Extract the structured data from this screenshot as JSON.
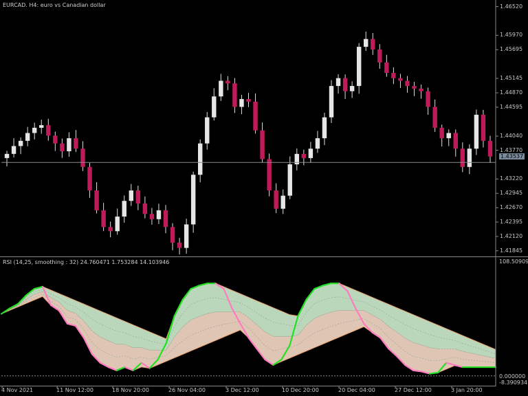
{
  "price_chart": {
    "symbol": "EURCAD.",
    "timeframe": "H4:",
    "description": "euro vs Canadian dollar",
    "price_axis_labels": [
      "1.46520",
      "1.45970",
      "1.45695",
      "1.45145",
      "1.44870",
      "1.44595",
      "1.44040",
      "1.43770",
      "1.43220",
      "1.42945",
      "1.42670",
      "1.42395",
      "1.42120",
      "1.41845"
    ],
    "current_price_label": "1.43537",
    "current_price": 1.43537
  },
  "indicator": {
    "header": "RSI (14,25, smoothing : 32) 24.760471 1.753284 14.103946",
    "axis_max_label": "108.509099",
    "axis_zero_label": "0.000000",
    "axis_min_label": "-8.390934"
  },
  "time_axis_labels": [
    "4 Nov 2021",
    "11 Nov 12:00",
    "18 Nov 20:00",
    "26 Nov 04:00",
    "3 Dec 12:00",
    "10 Dec 20:00",
    "20 Dec 04:00",
    "27 Dec 12:00",
    "3 Jan 20:00"
  ],
  "colors": {
    "background": "#000000",
    "candle": "#c01a5a",
    "candle_wick": "#e0e0e0",
    "rsi_up": "#22e022",
    "rsi_down": "#ff7ac0",
    "band_upper_fill": "#cfeecf",
    "band_lower_fill": "#f7dcc8",
    "band_edge": "#e8a070",
    "axis_text": "#c8c8c8"
  },
  "chart_data": {
    "type": "line",
    "title": "",
    "series": [
      {
        "name": "EURCAD.",
        "type": "candlestick",
        "x": [
          0,
          1,
          2,
          3,
          4,
          5,
          6,
          7,
          8,
          9,
          10,
          11,
          12,
          13,
          14,
          15,
          16,
          17,
          18,
          19,
          20,
          21,
          22,
          23,
          24,
          25,
          26,
          27,
          28,
          29,
          30,
          31,
          32,
          33,
          34,
          35,
          36,
          37,
          38,
          39,
          40,
          41,
          42,
          43,
          44,
          45,
          46,
          47,
          48,
          49,
          50,
          51,
          52,
          53,
          54,
          55,
          56,
          57,
          58,
          59,
          60,
          61,
          62,
          63,
          64,
          65,
          66,
          67,
          68,
          69,
          70
        ],
        "values": [
          1.437,
          1.4385,
          1.4395,
          1.441,
          1.442,
          1.4425,
          1.4405,
          1.439,
          1.4375,
          1.44,
          1.438,
          1.4345,
          1.43,
          1.4262,
          1.423,
          1.4222,
          1.425,
          1.428,
          1.43,
          1.4275,
          1.4255,
          1.4245,
          1.4262,
          1.423,
          1.42,
          1.419,
          1.4235,
          1.433,
          1.439,
          1.444,
          1.448,
          1.451,
          1.4505,
          1.446,
          1.4475,
          1.447,
          1.4415,
          1.436,
          1.43,
          1.4265,
          1.429,
          1.435,
          1.437,
          1.4362,
          1.438,
          1.44,
          1.444,
          1.45,
          1.4515,
          1.449,
          1.45,
          1.4575,
          1.459,
          1.457,
          1.4545,
          1.4525,
          1.4515,
          1.451,
          1.45,
          1.4495,
          1.449,
          1.446,
          1.442,
          1.44,
          1.441,
          1.438,
          1.4345,
          1.438,
          1.4445,
          1.4395,
          1.4365
        ]
      },
      {
        "name": "RSI",
        "x": [
          0,
          4,
          8,
          12,
          16,
          20,
          24,
          28,
          32,
          36,
          40,
          44,
          48,
          52,
          56,
          60,
          64,
          68,
          72,
          76,
          80,
          84,
          88,
          92,
          96,
          100,
          104,
          108,
          112,
          116,
          120,
          124,
          128,
          132,
          136,
          140,
          144,
          148,
          152,
          156,
          160,
          164,
          168,
          172,
          176,
          180,
          184,
          188,
          192,
          196,
          200,
          204,
          208,
          212,
          216,
          220,
          224,
          228,
          232,
          236,
          240
        ],
        "values": [
          57,
          62,
          66,
          74,
          80,
          82,
          65,
          60,
          48,
          46,
          35,
          20,
          12,
          8,
          5,
          8,
          5,
          12,
          7,
          15,
          30,
          55,
          70,
          80,
          83,
          85,
          85,
          80,
          62,
          48,
          35,
          25,
          15,
          10,
          15,
          28,
          55,
          70,
          80,
          83,
          85,
          85,
          78,
          62,
          48,
          40,
          35,
          25,
          18,
          10,
          5,
          4,
          2,
          3,
          12,
          10,
          8,
          8,
          8,
          8,
          8
        ]
      }
    ],
    "xlabel": "",
    "ylabel": "",
    "ylim": [
      -8.390934,
      108.509099
    ],
    "grid": false
  }
}
